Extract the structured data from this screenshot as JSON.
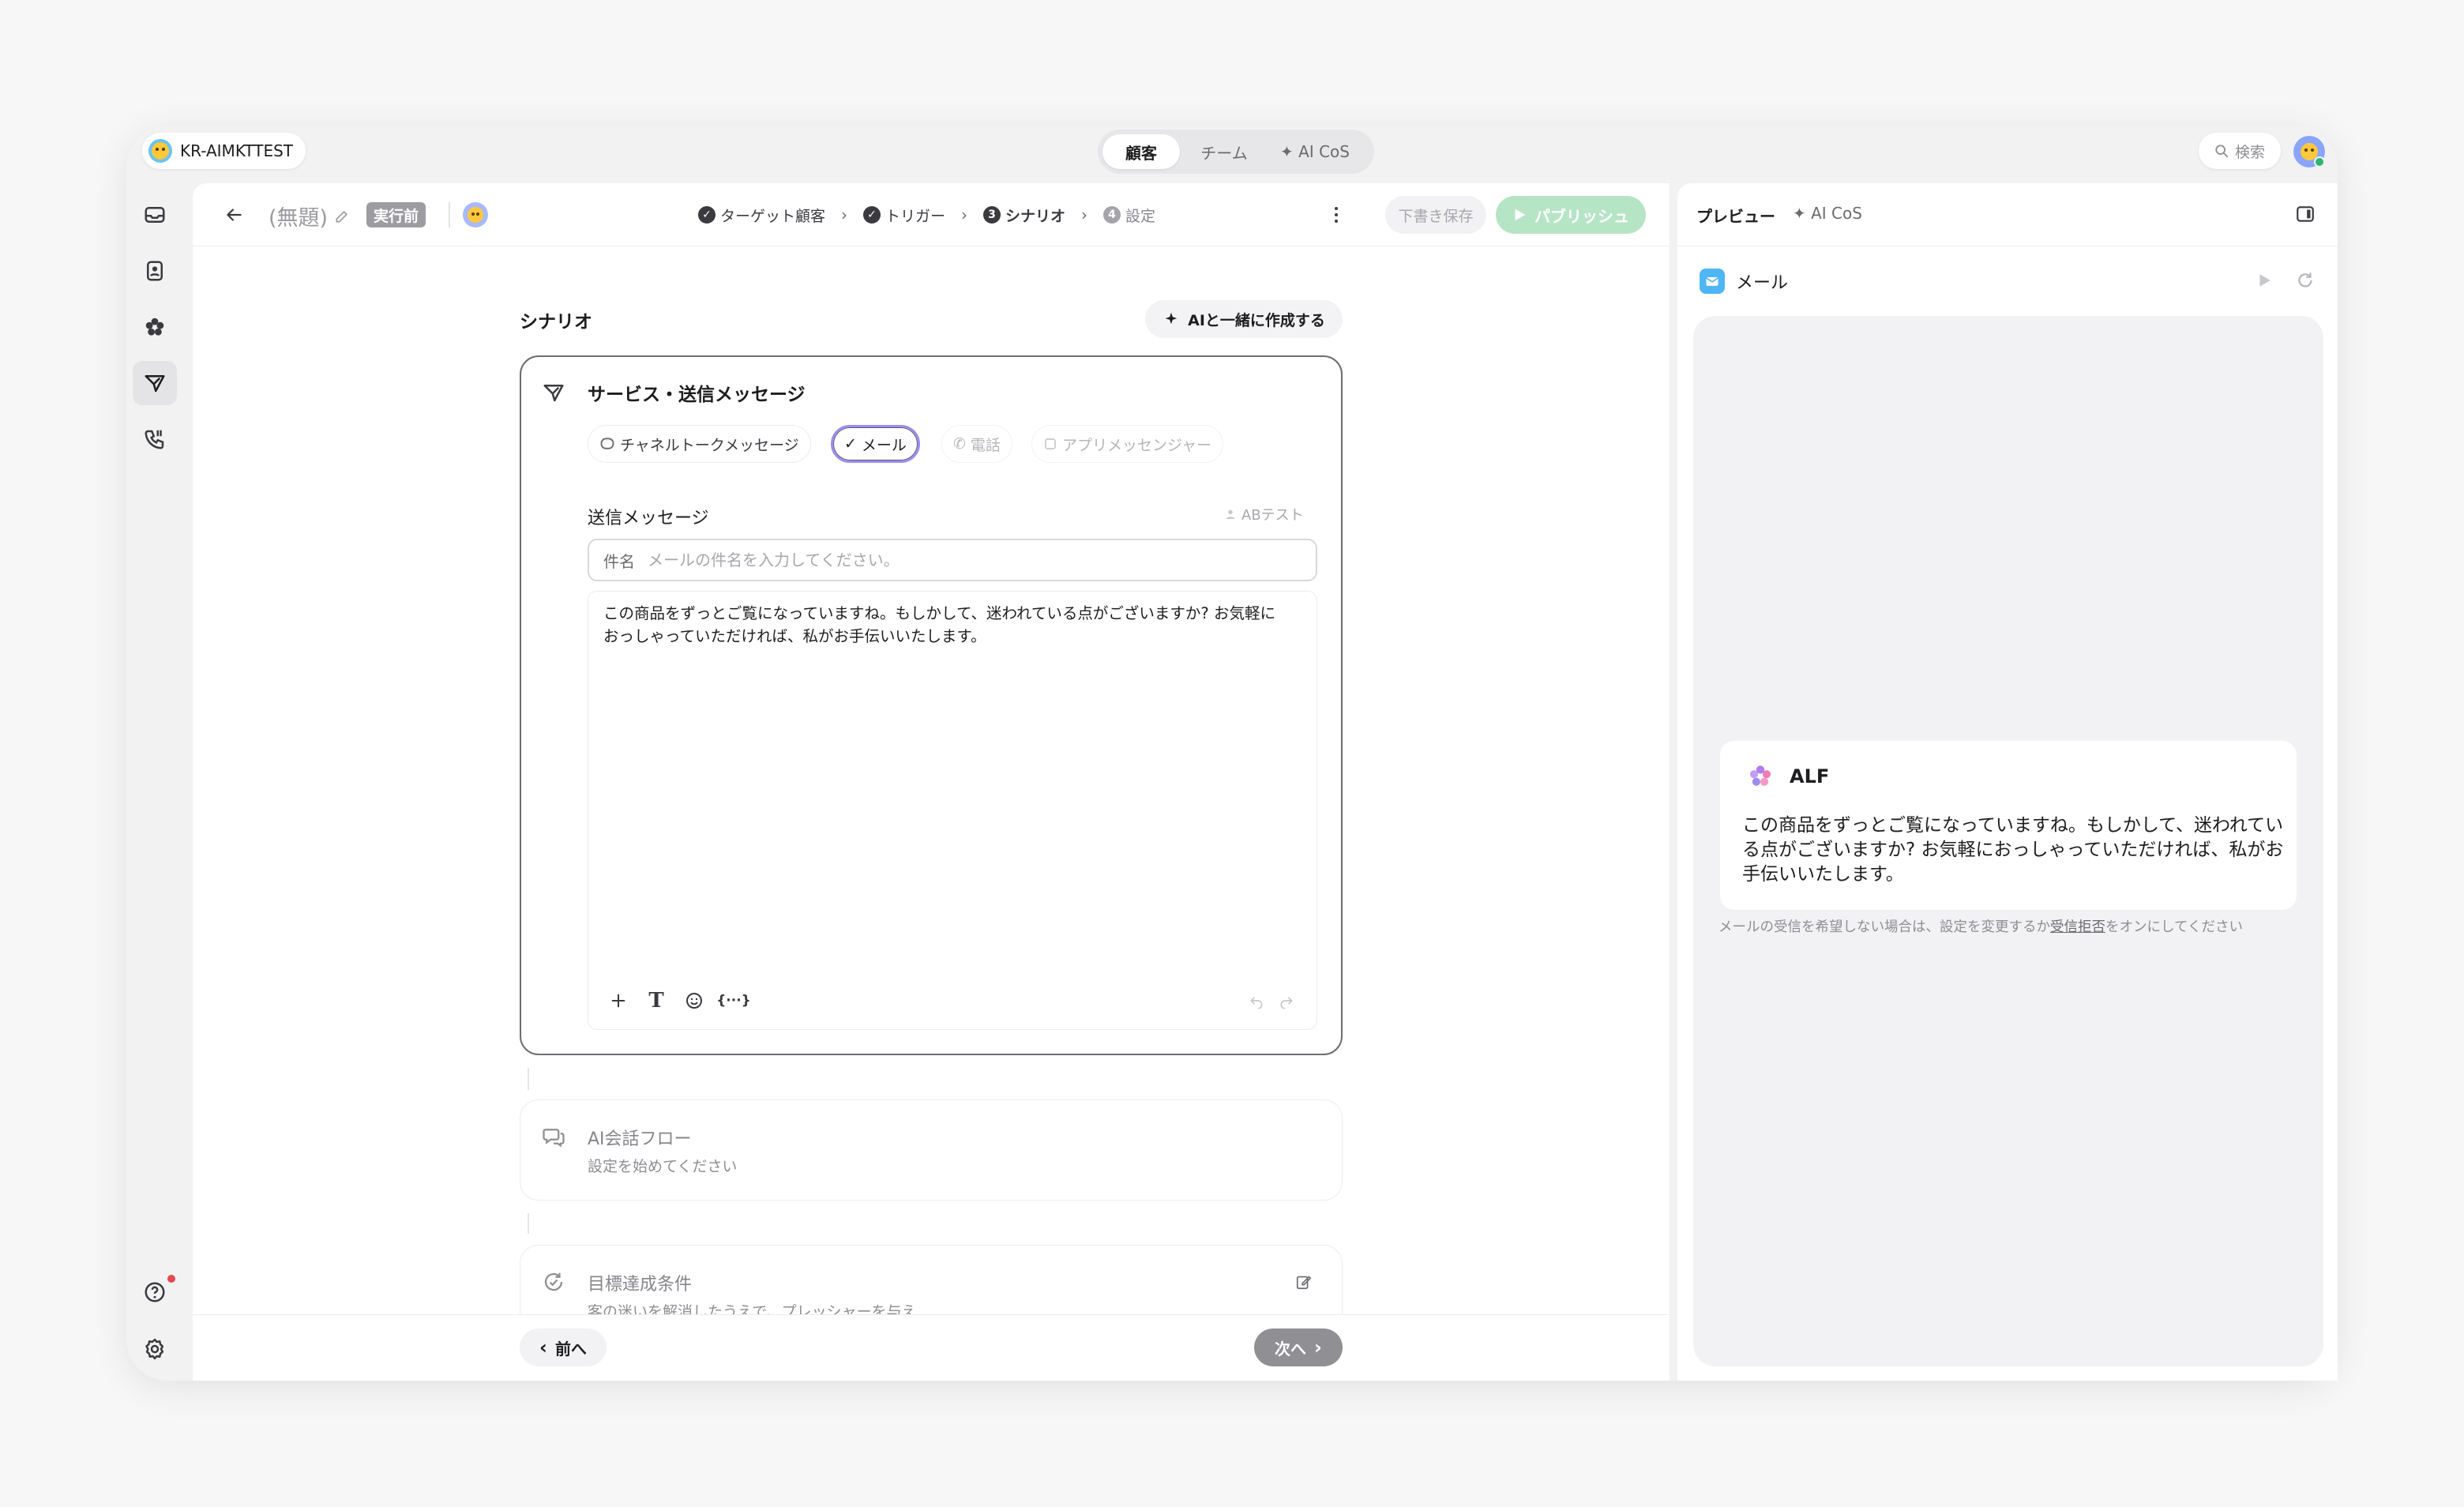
{
  "workspace": {
    "name": "KR-AIMKTTEST"
  },
  "top_nav": {
    "tabs": [
      {
        "label": "顧客",
        "active": true
      },
      {
        "label": "チーム",
        "active": false
      },
      {
        "label": "✦ AI CoS",
        "active": false
      }
    ]
  },
  "search": {
    "label": "検索"
  },
  "header": {
    "title": "(無題)",
    "status_badge": "実行前",
    "steps": [
      {
        "label": "ターゲット顧客",
        "state": "done"
      },
      {
        "label": "トリガー",
        "state": "done"
      },
      {
        "num": "3",
        "label": "シナリオ",
        "state": "current"
      },
      {
        "num": "4",
        "label": "設定",
        "state": "todo"
      }
    ],
    "draft_label": "下書き保存",
    "publish_label": "パブリッシュ"
  },
  "scenario": {
    "title": "シナリオ",
    "ai_button": "AIと一緒に作成する",
    "card_title": "サービス・送信メッセージ",
    "channels": [
      {
        "label": "チャネルトークメッセージ",
        "state": "normal"
      },
      {
        "label": "メール",
        "state": "selected"
      },
      {
        "label": "電話",
        "state": "disabled"
      },
      {
        "label": "アプリメッセンジャー",
        "state": "disabled"
      }
    ],
    "message_label": "送信メッセージ",
    "ab_test": "ABテスト",
    "subject_label": "件名",
    "subject_placeholder": "メールの件名を入力してください。",
    "subject_value": "",
    "body_line1": "この商品をずっとご覧になっていますね。もしかして、迷われている点がございますか? お気軽に",
    "body_line2": "おっしゃっていただければ、私がお手伝いいたします。",
    "ai_flow_title": "AI会話フロー",
    "ai_flow_sub": "設定を始めてください",
    "goal_title": "目標達成条件",
    "goal_sub": "客の迷いを解消したうえで、プレッシャーを与え..."
  },
  "footer": {
    "prev": "前へ",
    "next": "次へ"
  },
  "preview": {
    "tab_preview": "プレビュー",
    "tab_aicos": "✦ AI CoS",
    "channel": "メール",
    "sender": "ALF",
    "message": "この商品をずっとご覧になっていますね。もしかして、迷われている点がございますか? お気軽におっしゃっていただければ、私がお手伝いいたします。",
    "unsub_prefix": "メールの受信を希望しない場合は、設定を変更するか",
    "unsub_link": "受信拒否",
    "unsub_suffix": "をオンにしてください"
  },
  "colors": {
    "publish_bg": "#b6e5c6",
    "selected_border": "#9d8cf2",
    "mail_icon": "#4fb6f5",
    "online": "#2bb673",
    "notify_dot": "#e5484d"
  }
}
